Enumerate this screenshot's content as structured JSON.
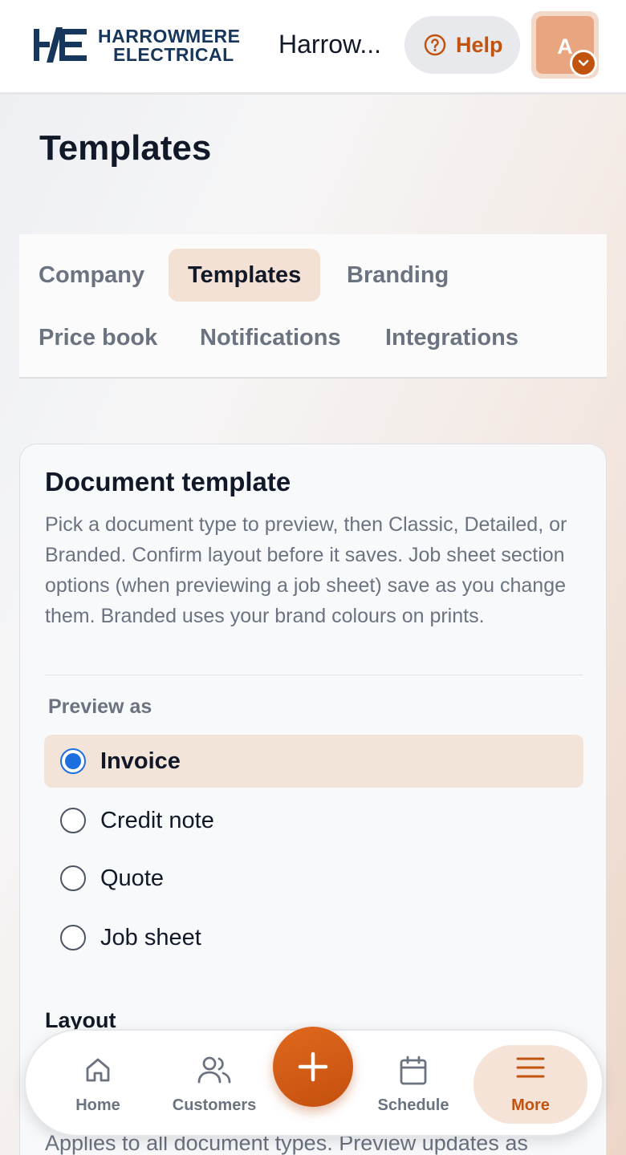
{
  "header": {
    "logo_line1": "HARROWMERE",
    "logo_line2": "ELECTRICAL",
    "company_name": "Harrow...",
    "help_label": "Help",
    "avatar_initial": "A"
  },
  "page": {
    "title": "Templates"
  },
  "tabs": [
    {
      "label": "Company",
      "active": false
    },
    {
      "label": "Templates",
      "active": true
    },
    {
      "label": "Branding",
      "active": false
    },
    {
      "label": "Price book",
      "active": false
    },
    {
      "label": "Notifications",
      "active": false
    },
    {
      "label": "Integrations",
      "active": false
    }
  ],
  "document_template": {
    "title": "Document template",
    "description": "Pick a document type to preview, then Classic, Detailed, or Branded. Confirm layout before it saves. Job sheet section options (when previewing a job sheet) save as you change them. Branded uses your brand colours on prints.",
    "preview_label": "Preview as",
    "options": [
      {
        "label": "Invoice",
        "selected": true
      },
      {
        "label": "Credit note",
        "selected": false
      },
      {
        "label": "Quote",
        "selected": false
      },
      {
        "label": "Job sheet",
        "selected": false
      }
    ],
    "layout_label": "Layout",
    "layout_description": "Applies to all document types. Preview updates as"
  },
  "bottom_nav": {
    "items": [
      {
        "label": "Home",
        "icon": "home-icon",
        "active": false
      },
      {
        "label": "Customers",
        "icon": "users-icon",
        "active": false
      },
      {
        "label": "Schedule",
        "icon": "calendar-icon",
        "active": false
      },
      {
        "label": "More",
        "icon": "menu-icon",
        "active": true
      }
    ],
    "fab_icon": "plus-icon"
  },
  "colors": {
    "accent": "#c2530f",
    "accent_soft": "#f3e1d6",
    "radio_selected": "#1d6fe0",
    "navy": "#17365c"
  }
}
